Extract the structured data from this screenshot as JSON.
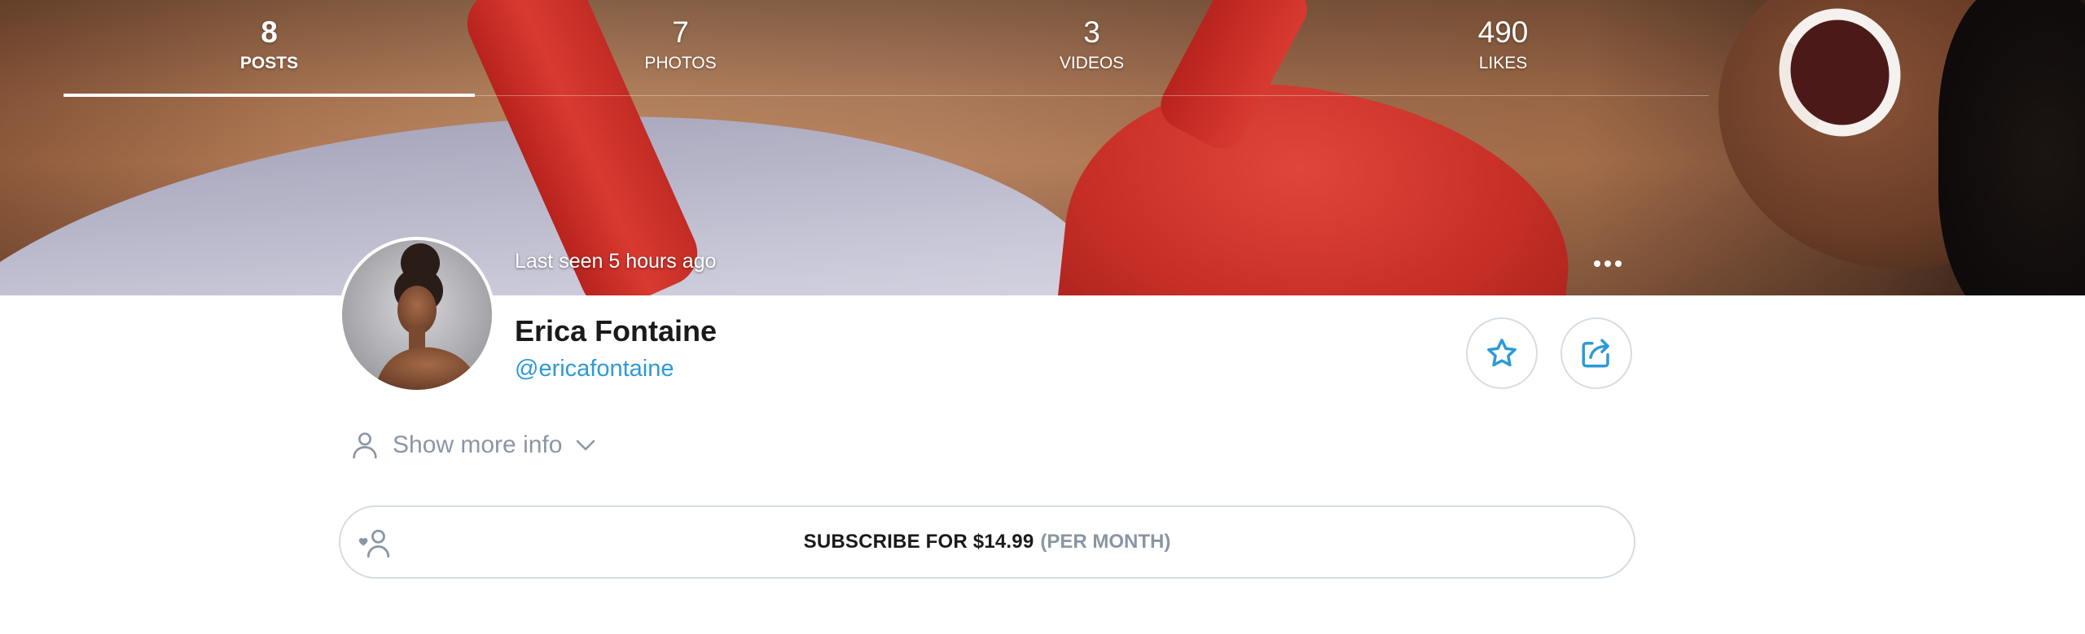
{
  "stats": [
    {
      "value": "8",
      "label": "POSTS"
    },
    {
      "value": "7",
      "label": "PHOTOS"
    },
    {
      "value": "3",
      "label": "VIDEOS"
    },
    {
      "value": "490",
      "label": "LIKES"
    }
  ],
  "active_tab": "POSTS",
  "last_seen": "Last seen 5 hours ago",
  "profile": {
    "name": "Erica Fontaine",
    "handle": "@ericafontaine"
  },
  "icons": {
    "more": "more-dots-icon",
    "favorite": "star-icon",
    "share": "share-icon",
    "user": "user-icon",
    "chevron": "chevron-down-icon",
    "subscribe": "heart-user-icon"
  },
  "show_more": "Show more info",
  "subscribe": {
    "main": "SUBSCRIBE FOR $14.99",
    "period": "(PER MONTH)"
  },
  "colors": {
    "accent": "#2d9ad8",
    "muted": "#8a96a3",
    "border": "#d6dde3"
  }
}
